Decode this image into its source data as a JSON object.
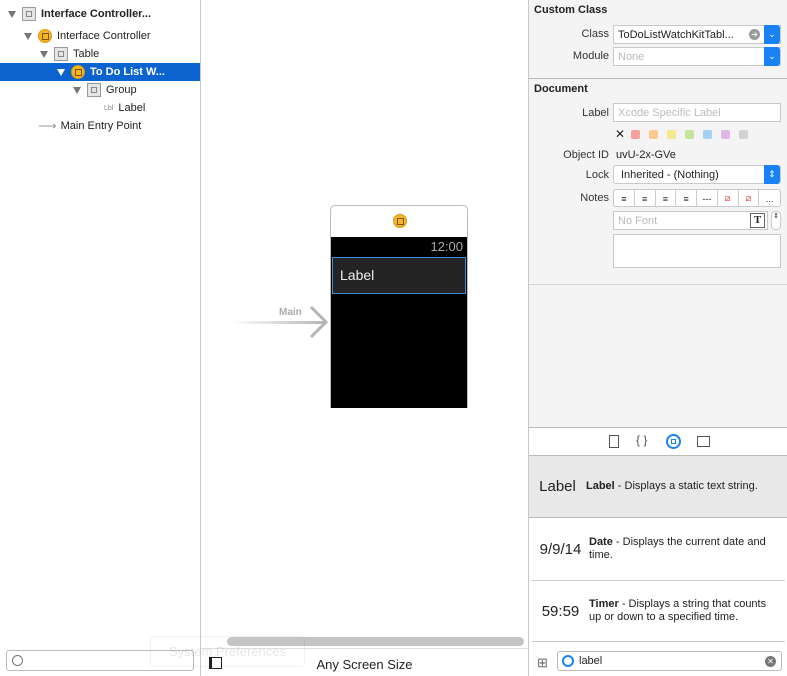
{
  "outline": {
    "items": [
      {
        "label": "Interface Controller...",
        "bold": true
      },
      {
        "label": "Interface Controller"
      },
      {
        "label": "Table"
      },
      {
        "label": "To Do List W...",
        "selected": true
      },
      {
        "label": "Group"
      },
      {
        "label": "Label",
        "prefix": "Lbl"
      },
      {
        "label": "Main Entry Point"
      }
    ]
  },
  "canvas": {
    "entry_label": "Main",
    "time": "12:00",
    "row_label": "Label",
    "size_class": "Any Screen Size",
    "ghost_text": "System Preferences"
  },
  "inspector": {
    "custom_class": {
      "title": "Custom Class",
      "class_label": "Class",
      "class_value": "ToDoListWatchKitTabl...",
      "module_label": "Module",
      "module_placeholder": "None"
    },
    "document": {
      "title": "Document",
      "label_label": "Label",
      "label_placeholder": "Xcode Specific Label",
      "object_id_label": "Object ID",
      "object_id": "uvU-2x-GVe",
      "lock_label": "Lock",
      "lock_value": "Inherited - (Nothing)",
      "notes_label": "Notes",
      "font_placeholder": "No Font",
      "more": "..."
    },
    "label_colors": [
      "#f7a0a0",
      "#fcc98e",
      "#f7e890",
      "#c5e59a",
      "#a6d1f7",
      "#e0b6e8",
      "#d2d2d2"
    ]
  },
  "library": {
    "tabs": [
      "file-icon",
      "braces-icon",
      "object-icon",
      "media-icon"
    ],
    "active_tab": 2,
    "items": [
      {
        "icon_text": "Label",
        "name": "Label",
        "desc": " - Displays a static text string.",
        "selected": true
      },
      {
        "icon_text": "9/9/14",
        "name": "Date",
        "desc": " - Displays the current date and time."
      },
      {
        "icon_text": "59:59",
        "name": "Timer",
        "desc": " - Displays a string that counts up or down to a specified time."
      }
    ],
    "filter_value": "label"
  },
  "colors": {
    "selection": "#0a63cf",
    "accent": "#1a82f7",
    "controller": "#f5b624"
  }
}
